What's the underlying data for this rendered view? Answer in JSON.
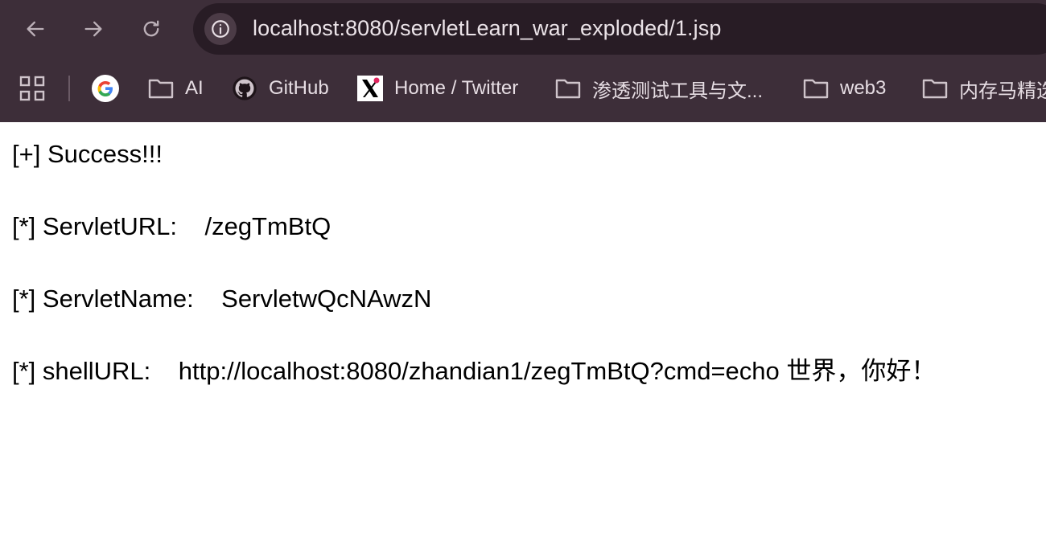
{
  "browser": {
    "url": "localhost:8080/servletLearn_war_exploded/1.jsp",
    "bookmarks": [
      {
        "label": "AI",
        "icon": "folder-icon"
      },
      {
        "label": "GitHub",
        "icon": "github-icon"
      },
      {
        "label": "Home / Twitter",
        "icon": "x-twitter-icon"
      },
      {
        "label": "渗透测试工具与文...",
        "icon": "folder-icon"
      },
      {
        "label": "web3",
        "icon": "folder-icon"
      },
      {
        "label": "内存马精选",
        "icon": "folder-icon"
      }
    ]
  },
  "page": {
    "lines": [
      "[+] Success!!!",
      "[*] ServletURL:    /zegTmBtQ",
      "[*] ServletName:    ServletwQcNAwzN",
      "[*] shellURL:    http://localhost:8080/zhandian1/zegTmBtQ?cmd=echo 世界，你好！"
    ]
  }
}
